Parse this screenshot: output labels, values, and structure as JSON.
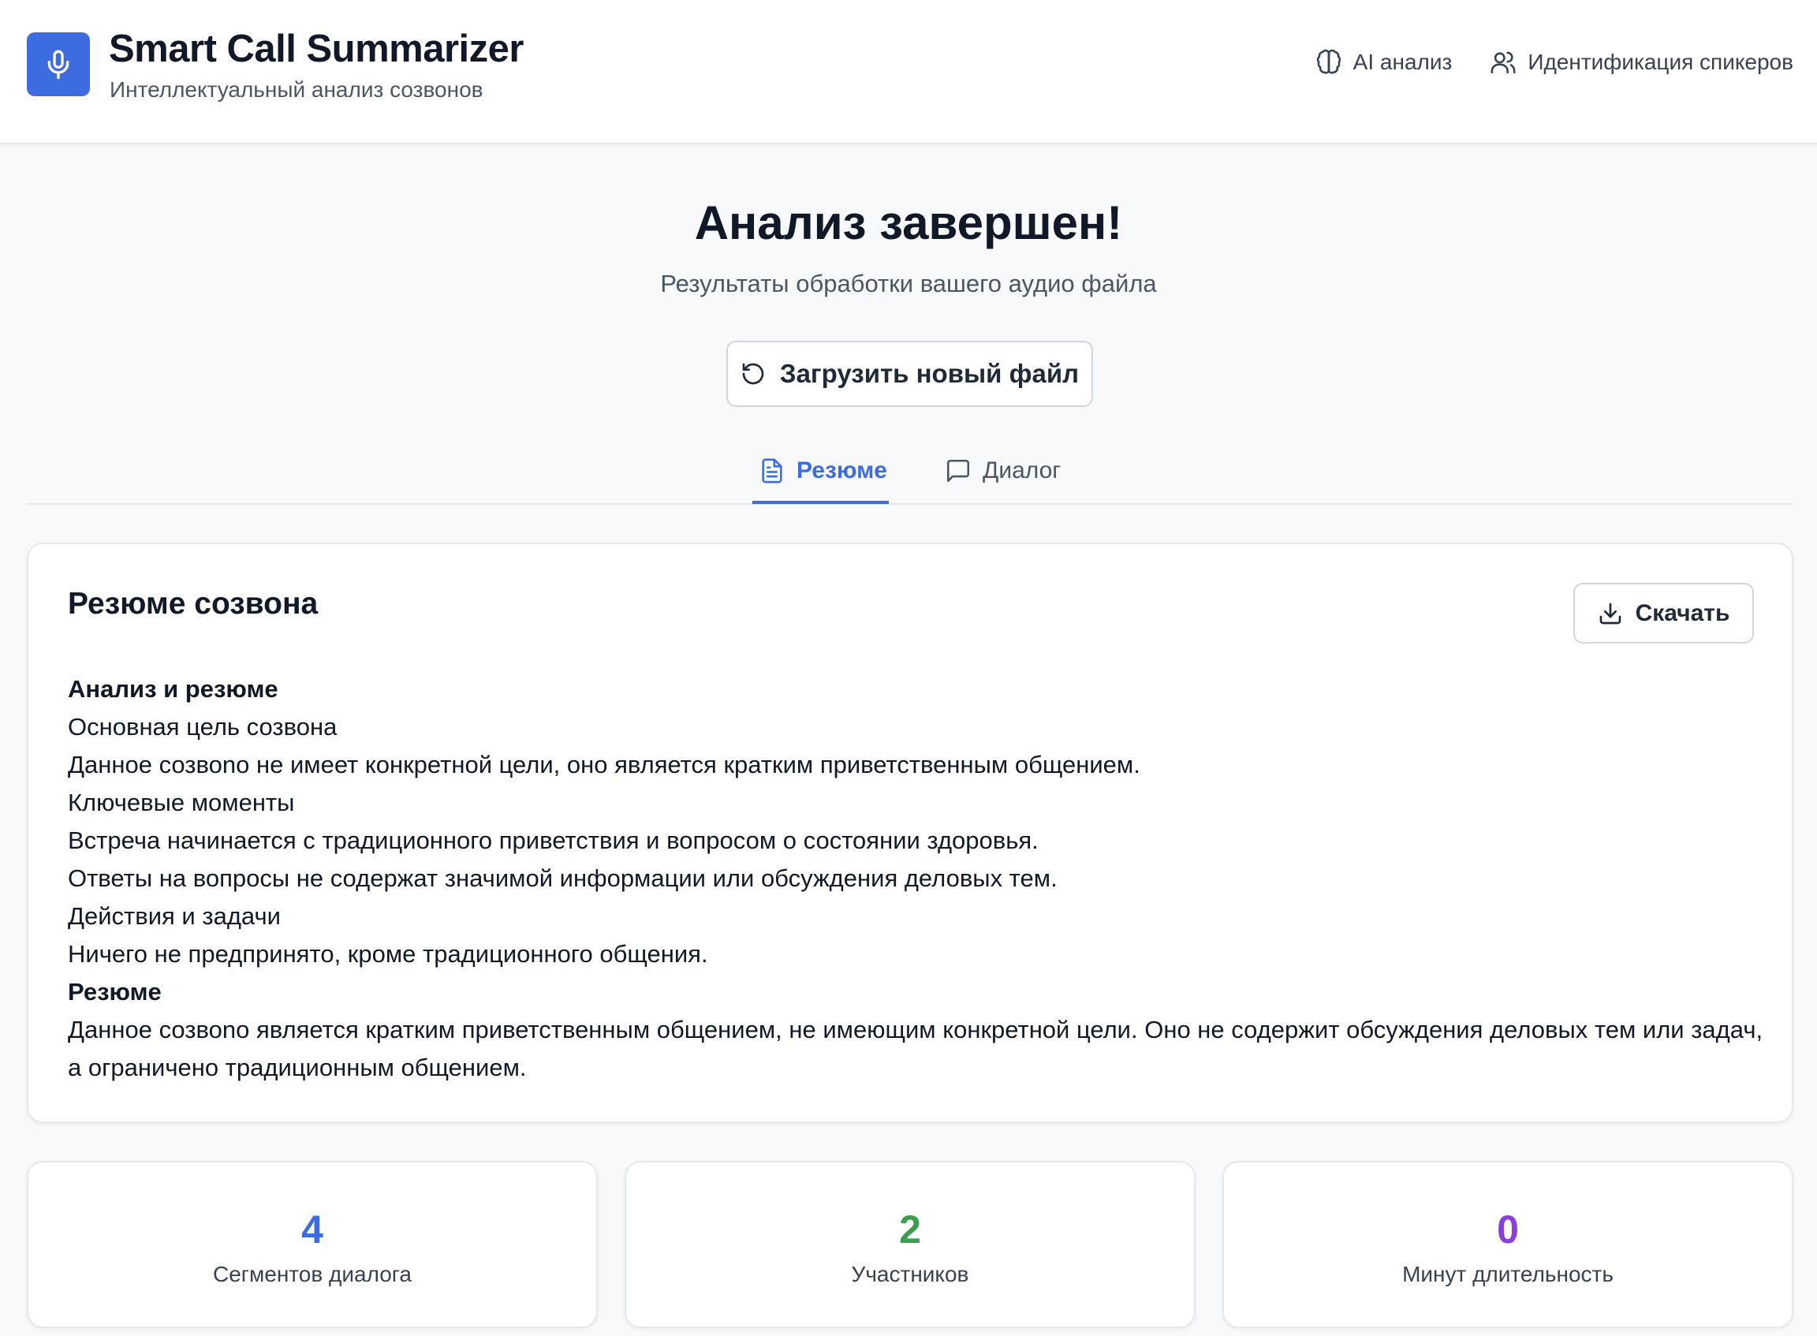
{
  "app": {
    "title": "Smart Call Summarizer",
    "subtitle": "Интеллектуальный анализ созвонов",
    "logo_icon": "microphone-icon",
    "accent_color": "#3d6be0"
  },
  "header_nav": {
    "ai_label": "AI анализ",
    "ai_icon": "brain-icon",
    "speakers_label": "Идентификация спикеров",
    "speakers_icon": "users-icon"
  },
  "page": {
    "heading": "Анализ завершен!",
    "subheading": "Результаты обработки вашего аудио файла",
    "upload_label": "Загрузить новый файл",
    "upload_icon": "rotate-ccw-icon"
  },
  "tabs": [
    {
      "label": "Резюме",
      "icon": "file-text-icon",
      "active": true
    },
    {
      "label": "Диалог",
      "icon": "message-square-icon",
      "active": false
    }
  ],
  "summary_card": {
    "title": "Резюме созвона",
    "download_label": "Скачать",
    "download_icon": "download-icon",
    "lines": [
      {
        "text": "Анализ и резюме",
        "bold": true
      },
      {
        "text": "Основная цель созвона",
        "bold": false
      },
      {
        "text": "Данное созвоno не имеет конкретной цели, оно является кратким приветственным общением.",
        "bold": false
      },
      {
        "text": "Ключевые моменты",
        "bold": false
      },
      {
        "text": "Встреча начинается с традиционного приветствия и вопросом о состоянии здоровья.",
        "bold": false
      },
      {
        "text": "Ответы на вопросы не содержат значимой информации или обсуждения деловых тем.",
        "bold": false
      },
      {
        "text": "Действия и задачи",
        "bold": false
      },
      {
        "text": "Ничего не предпринято, кроме традиционного общения.",
        "bold": false
      },
      {
        "text": "Резюме",
        "bold": true
      },
      {
        "text": "Данное созвоno является кратким приветственным общением, не имеющим конкретной цели. Оно не содержит обсуждения деловых тем или задач, а ограничено традиционным общением.",
        "bold": false
      }
    ]
  },
  "stats": [
    {
      "value": "4",
      "label": "Сегментов диалога",
      "color": "#3d6be0"
    },
    {
      "value": "2",
      "label": "Участников",
      "color": "#3a9d4f"
    },
    {
      "value": "0",
      "label": "Минут длительность",
      "color": "#8a3fdc"
    }
  ]
}
